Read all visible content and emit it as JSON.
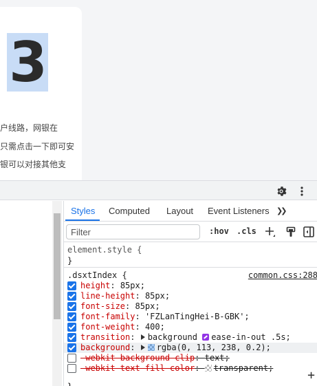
{
  "page": {
    "index_number": "3",
    "desc_lines": [
      "户线路，网银在",
      "只需点击一下即可安",
      "银可以对接其他支"
    ]
  },
  "toolbar": {
    "icons": [
      "gear-icon",
      "more-vertical-icon"
    ]
  },
  "tabs": [
    "Styles",
    "Computed",
    "Layout",
    "Event Listeners"
  ],
  "tabs_more": "❯❯",
  "filter": {
    "placeholder": "Filter",
    "hov": ":hov",
    "cls": ".cls"
  },
  "element_style": {
    "open": "element.style {",
    "close": "}"
  },
  "rule": {
    "selector": ".dsxtIndex {",
    "source": "common.css:288",
    "close": "}",
    "declarations": [
      {
        "name": "height",
        "value": "85px;",
        "enabled": true
      },
      {
        "name": "line-height",
        "value": "85px;",
        "enabled": true
      },
      {
        "name": "font-size",
        "value": "85px;",
        "enabled": true
      },
      {
        "name": "font-family",
        "value": "'FZLanTingHei-B-GBK';",
        "enabled": true
      },
      {
        "name": "font-weight",
        "value": "400;",
        "enabled": true
      },
      {
        "name": "transition",
        "value_a": "background",
        "value_b": "ease-in-out .5s;",
        "enabled": true
      },
      {
        "name": "background",
        "value": "rgba(0, 113, 238, 0.2);",
        "enabled": true,
        "swatch_color": "#c8dcf6"
      },
      {
        "name": "-webkit-background-clip",
        "value": "text;",
        "enabled": false
      },
      {
        "name": "-webkit-text-fill-color",
        "value": "transparent;",
        "enabled": false
      }
    ]
  },
  "colors": {
    "accent": "#1a73e8",
    "property_name": "#c80000",
    "highlight_bg": "#c8dcf6"
  }
}
